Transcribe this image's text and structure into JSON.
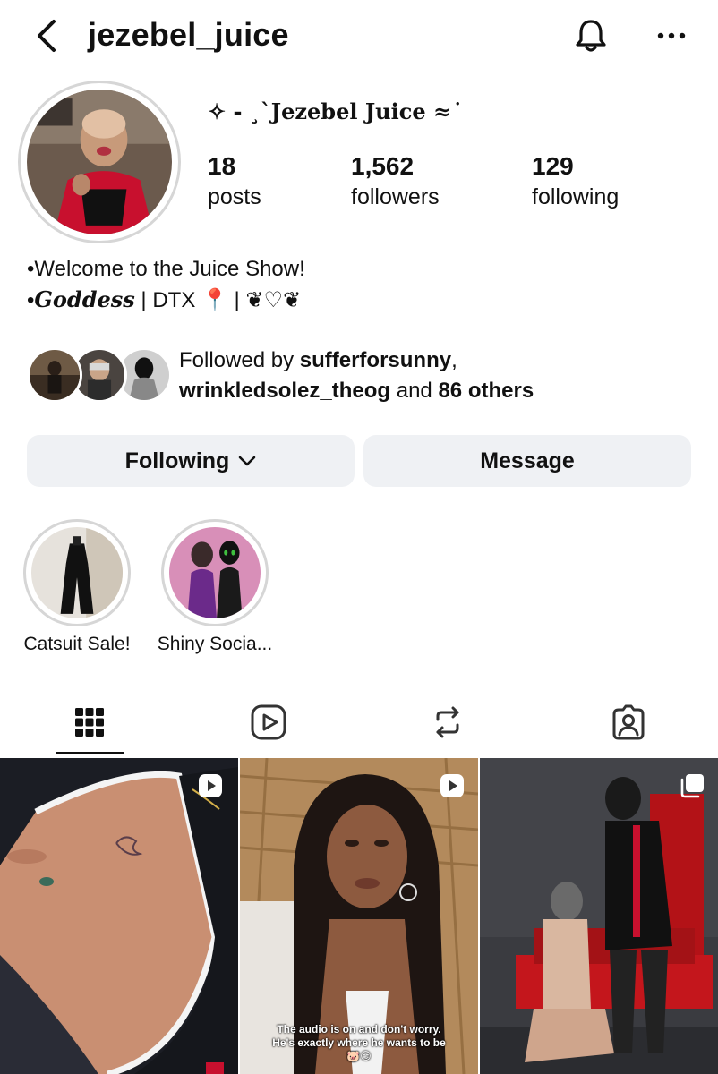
{
  "header": {
    "username": "jezebel_juice",
    "back_icon": "chevron-left-icon",
    "bell_icon": "bell-icon",
    "more_icon": "more-horizontal-icon"
  },
  "profile": {
    "display_name": "✧ - ¸`Jezebel Juice ≈ ͘",
    "stats": [
      {
        "value": "18",
        "label": "posts"
      },
      {
        "value": "1,562",
        "label": "followers"
      },
      {
        "value": "129",
        "label": "following"
      }
    ],
    "bio": {
      "line1": "•Welcome to the Juice Show!",
      "line2_prefix": "•",
      "line2_goddess": "Goddess",
      "line2_rest": " | DTX 📍 | ❦♡❦"
    }
  },
  "followed_by": {
    "prefix": "Followed by ",
    "user1": "sufferforsunny",
    "sep": ",",
    "user2": "wrinkledsolez_theog",
    "and": " and ",
    "others": "86 others"
  },
  "actions": {
    "following_label": "Following",
    "message_label": "Message"
  },
  "highlights": [
    {
      "label": "Catsuit Sale!"
    },
    {
      "label": "Shiny Socia..."
    }
  ],
  "tabs": [
    {
      "name": "grid",
      "icon": "grid-icon"
    },
    {
      "name": "reels",
      "icon": "reels-icon"
    },
    {
      "name": "reposts",
      "icon": "repost-icon"
    },
    {
      "name": "tagged",
      "icon": "tagged-icon"
    }
  ],
  "posts": [
    {
      "type": "reel",
      "caption": ""
    },
    {
      "type": "reel",
      "caption_line1": "The audio is on and don't worry.",
      "caption_line2": "He's exactly where he wants to be",
      "caption_line3": "🐷😏"
    },
    {
      "type": "carousel",
      "caption": ""
    }
  ],
  "colors": {
    "button_bg": "#eff1f4",
    "ring": "#d6d6d6",
    "text": "#111111"
  }
}
